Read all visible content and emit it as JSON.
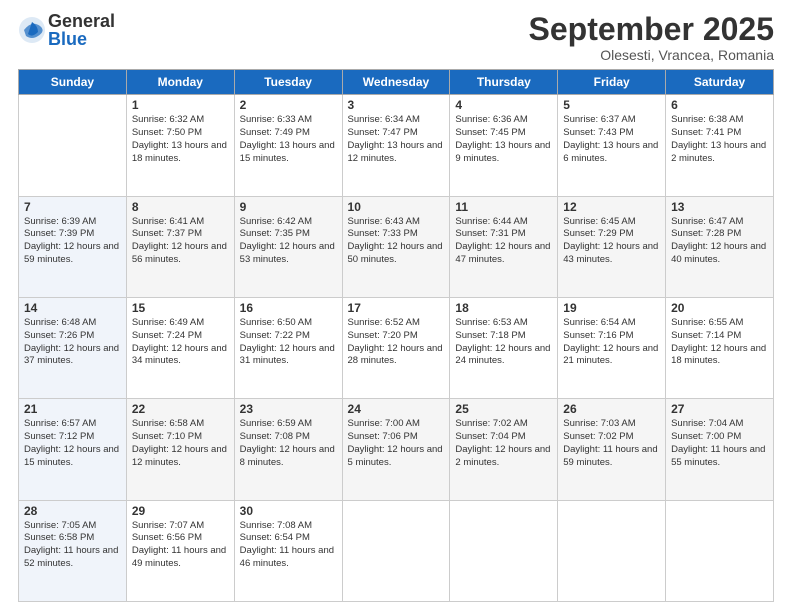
{
  "logo": {
    "general": "General",
    "blue": "Blue"
  },
  "header": {
    "month": "September 2025",
    "location": "Olesesti, Vrancea, Romania"
  },
  "weekdays": [
    "Sunday",
    "Monday",
    "Tuesday",
    "Wednesday",
    "Thursday",
    "Friday",
    "Saturday"
  ],
  "weeks": [
    [
      {
        "day": "",
        "sunrise": "",
        "sunset": "",
        "daylight": ""
      },
      {
        "day": "1",
        "sunrise": "6:32 AM",
        "sunset": "7:50 PM",
        "daylight": "13 hours and 18 minutes."
      },
      {
        "day": "2",
        "sunrise": "6:33 AM",
        "sunset": "7:49 PM",
        "daylight": "13 hours and 15 minutes."
      },
      {
        "day": "3",
        "sunrise": "6:34 AM",
        "sunset": "7:47 PM",
        "daylight": "13 hours and 12 minutes."
      },
      {
        "day": "4",
        "sunrise": "6:36 AM",
        "sunset": "7:45 PM",
        "daylight": "13 hours and 9 minutes."
      },
      {
        "day": "5",
        "sunrise": "6:37 AM",
        "sunset": "7:43 PM",
        "daylight": "13 hours and 6 minutes."
      },
      {
        "day": "6",
        "sunrise": "6:38 AM",
        "sunset": "7:41 PM",
        "daylight": "13 hours and 2 minutes."
      }
    ],
    [
      {
        "day": "7",
        "sunrise": "6:39 AM",
        "sunset": "7:39 PM",
        "daylight": "12 hours and 59 minutes."
      },
      {
        "day": "8",
        "sunrise": "6:41 AM",
        "sunset": "7:37 PM",
        "daylight": "12 hours and 56 minutes."
      },
      {
        "day": "9",
        "sunrise": "6:42 AM",
        "sunset": "7:35 PM",
        "daylight": "12 hours and 53 minutes."
      },
      {
        "day": "10",
        "sunrise": "6:43 AM",
        "sunset": "7:33 PM",
        "daylight": "12 hours and 50 minutes."
      },
      {
        "day": "11",
        "sunrise": "6:44 AM",
        "sunset": "7:31 PM",
        "daylight": "12 hours and 47 minutes."
      },
      {
        "day": "12",
        "sunrise": "6:45 AM",
        "sunset": "7:29 PM",
        "daylight": "12 hours and 43 minutes."
      },
      {
        "day": "13",
        "sunrise": "6:47 AM",
        "sunset": "7:28 PM",
        "daylight": "12 hours and 40 minutes."
      }
    ],
    [
      {
        "day": "14",
        "sunrise": "6:48 AM",
        "sunset": "7:26 PM",
        "daylight": "12 hours and 37 minutes."
      },
      {
        "day": "15",
        "sunrise": "6:49 AM",
        "sunset": "7:24 PM",
        "daylight": "12 hours and 34 minutes."
      },
      {
        "day": "16",
        "sunrise": "6:50 AM",
        "sunset": "7:22 PM",
        "daylight": "12 hours and 31 minutes."
      },
      {
        "day": "17",
        "sunrise": "6:52 AM",
        "sunset": "7:20 PM",
        "daylight": "12 hours and 28 minutes."
      },
      {
        "day": "18",
        "sunrise": "6:53 AM",
        "sunset": "7:18 PM",
        "daylight": "12 hours and 24 minutes."
      },
      {
        "day": "19",
        "sunrise": "6:54 AM",
        "sunset": "7:16 PM",
        "daylight": "12 hours and 21 minutes."
      },
      {
        "day": "20",
        "sunrise": "6:55 AM",
        "sunset": "7:14 PM",
        "daylight": "12 hours and 18 minutes."
      }
    ],
    [
      {
        "day": "21",
        "sunrise": "6:57 AM",
        "sunset": "7:12 PM",
        "daylight": "12 hours and 15 minutes."
      },
      {
        "day": "22",
        "sunrise": "6:58 AM",
        "sunset": "7:10 PM",
        "daylight": "12 hours and 12 minutes."
      },
      {
        "day": "23",
        "sunrise": "6:59 AM",
        "sunset": "7:08 PM",
        "daylight": "12 hours and 8 minutes."
      },
      {
        "day": "24",
        "sunrise": "7:00 AM",
        "sunset": "7:06 PM",
        "daylight": "12 hours and 5 minutes."
      },
      {
        "day": "25",
        "sunrise": "7:02 AM",
        "sunset": "7:04 PM",
        "daylight": "12 hours and 2 minutes."
      },
      {
        "day": "26",
        "sunrise": "7:03 AM",
        "sunset": "7:02 PM",
        "daylight": "11 hours and 59 minutes."
      },
      {
        "day": "27",
        "sunrise": "7:04 AM",
        "sunset": "7:00 PM",
        "daylight": "11 hours and 55 minutes."
      }
    ],
    [
      {
        "day": "28",
        "sunrise": "7:05 AM",
        "sunset": "6:58 PM",
        "daylight": "11 hours and 52 minutes."
      },
      {
        "day": "29",
        "sunrise": "7:07 AM",
        "sunset": "6:56 PM",
        "daylight": "11 hours and 49 minutes."
      },
      {
        "day": "30",
        "sunrise": "7:08 AM",
        "sunset": "6:54 PM",
        "daylight": "11 hours and 46 minutes."
      },
      {
        "day": "",
        "sunrise": "",
        "sunset": "",
        "daylight": ""
      },
      {
        "day": "",
        "sunrise": "",
        "sunset": "",
        "daylight": ""
      },
      {
        "day": "",
        "sunrise": "",
        "sunset": "",
        "daylight": ""
      },
      {
        "day": "",
        "sunrise": "",
        "sunset": "",
        "daylight": ""
      }
    ]
  ]
}
